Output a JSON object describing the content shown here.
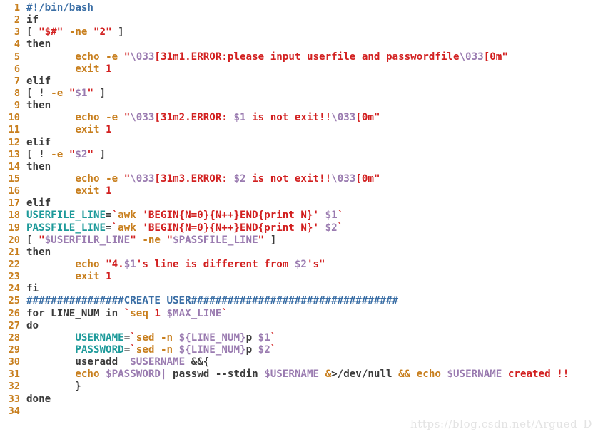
{
  "editor": {
    "language": "bash",
    "background_color": "#ffffff",
    "gutter_color": "#c87f1e",
    "colors": {
      "comment": "#3a6ea5",
      "string": "#d22020",
      "variable": "#9a7bb0",
      "command": "#c87f1e",
      "assignment_target": "#1d9a9a",
      "plain": "#3b3b3b",
      "number": "#d22020"
    },
    "total_lines": 34,
    "cursor_line": 16
  },
  "watermark": {
    "text": "https://blog.csdn.net/Argued_D"
  },
  "lines": [
    {
      "n": "1",
      "text": "#!/bin/bash"
    },
    {
      "n": "2",
      "text": "if"
    },
    {
      "n": "3",
      "text": "[ \"$#\" -ne \"2\" ]"
    },
    {
      "n": "4",
      "text": "then"
    },
    {
      "n": "5",
      "text": "        echo -e \"\\033[31m1.ERROR:please input userfile and passwordfile\\033[0m\""
    },
    {
      "n": "6",
      "text": "        exit 1"
    },
    {
      "n": "7",
      "text": "elif"
    },
    {
      "n": "8",
      "text": "[ ! -e \"$1\" ]"
    },
    {
      "n": "9",
      "text": "then"
    },
    {
      "n": "10",
      "text": "        echo -e \"\\033[31m2.ERROR: $1 is not exit!!\\033[0m\""
    },
    {
      "n": "11",
      "text": "        exit 1"
    },
    {
      "n": "12",
      "text": "elif"
    },
    {
      "n": "13",
      "text": "[ ! -e \"$2\" ]"
    },
    {
      "n": "14",
      "text": "then"
    },
    {
      "n": "15",
      "text": "        echo -e \"\\033[31m3.ERROR: $2 is not exit!!\\033[0m\""
    },
    {
      "n": "16",
      "text": "        exit 1"
    },
    {
      "n": "17",
      "text": "elif"
    },
    {
      "n": "18",
      "text": "USERFILE_LINE=`awk 'BEGIN{N=0}{N++}END{print N}' $1`"
    },
    {
      "n": "19",
      "text": "PASSFILE_LINE=`awk 'BEGIN{N=0}{N++}END{print N}' $2`"
    },
    {
      "n": "20",
      "text": "[ \"$USERFILR_LINE\" -ne \"$PASSFILE_LINE\" ]"
    },
    {
      "n": "21",
      "text": "then"
    },
    {
      "n": "22",
      "text": "        echo \"4.$1's line is different from $2's\""
    },
    {
      "n": "23",
      "text": "        exit 1"
    },
    {
      "n": "24",
      "text": "fi"
    },
    {
      "n": "25",
      "text": "################CREATE USER##################################"
    },
    {
      "n": "26",
      "text": "for LINE_NUM in `seq 1 $MAX_LINE`"
    },
    {
      "n": "27",
      "text": "do"
    },
    {
      "n": "28",
      "text": "        USERNAME=`sed -n ${LINE_NUM}p $1`"
    },
    {
      "n": "29",
      "text": "        PASSWORD=`sed -n ${LINE_NUM}p $2`"
    },
    {
      "n": "30",
      "text": "        useradd  $USERNAME &&{"
    },
    {
      "n": "31",
      "text": "        echo $PASSWORD| passwd --stdin $USERNAME &>/dev/null && echo $USERNAME created !!"
    },
    {
      "n": "32",
      "text": "        }"
    },
    {
      "n": "33",
      "text": "done"
    },
    {
      "n": "34",
      "text": ""
    }
  ],
  "highlight_spans": [
    {
      "line": 1,
      "spans": [
        [
          "#!/bin/bash",
          "comment"
        ]
      ]
    },
    {
      "line": 2,
      "spans": [
        [
          "if",
          "plain"
        ]
      ]
    },
    {
      "line": 3,
      "spans": [
        [
          "[ ",
          "plain"
        ],
        [
          "\"$#\"",
          "string"
        ],
        [
          " ",
          "plain"
        ],
        [
          "-ne",
          "command"
        ],
        [
          " ",
          "plain"
        ],
        [
          "\"",
          "string"
        ],
        [
          "2",
          "number"
        ],
        [
          "\"",
          "string"
        ],
        [
          " ]",
          "plain"
        ]
      ]
    },
    {
      "line": 4,
      "spans": [
        [
          "then",
          "plain"
        ]
      ]
    },
    {
      "line": 5,
      "spans": [
        [
          "        ",
          "plain"
        ],
        [
          "echo",
          "command"
        ],
        [
          " ",
          "plain"
        ],
        [
          "-e",
          "command"
        ],
        [
          " ",
          "plain"
        ],
        [
          "\"",
          "string"
        ],
        [
          "\\033",
          "variable"
        ],
        [
          "[31m1.ERROR:please input userfile and passwordfile",
          "string"
        ],
        [
          "\\033",
          "variable"
        ],
        [
          "[0m",
          "string"
        ],
        [
          "\"",
          "string"
        ]
      ]
    },
    {
      "line": 6,
      "spans": [
        [
          "        ",
          "plain"
        ],
        [
          "exit",
          "command"
        ],
        [
          " ",
          "plain"
        ],
        [
          "1",
          "number"
        ]
      ]
    },
    {
      "line": 7,
      "spans": [
        [
          "elif",
          "plain"
        ]
      ]
    },
    {
      "line": 8,
      "spans": [
        [
          "[ ! ",
          "plain"
        ],
        [
          "-e",
          "command"
        ],
        [
          " ",
          "plain"
        ],
        [
          "\"",
          "string"
        ],
        [
          "$1",
          "variable"
        ],
        [
          "\"",
          "string"
        ],
        [
          " ]",
          "plain"
        ]
      ]
    },
    {
      "line": 9,
      "spans": [
        [
          "then",
          "plain"
        ]
      ]
    },
    {
      "line": 10,
      "spans": [
        [
          "        ",
          "plain"
        ],
        [
          "echo",
          "command"
        ],
        [
          " ",
          "plain"
        ],
        [
          "-e",
          "command"
        ],
        [
          " ",
          "plain"
        ],
        [
          "\"",
          "string"
        ],
        [
          "\\033",
          "variable"
        ],
        [
          "[31m2.ERROR: ",
          "string"
        ],
        [
          "$1",
          "variable"
        ],
        [
          " is not exit!!",
          "string"
        ],
        [
          "\\033",
          "variable"
        ],
        [
          "[0m",
          "string"
        ],
        [
          "\"",
          "string"
        ]
      ]
    },
    {
      "line": 11,
      "spans": [
        [
          "        ",
          "plain"
        ],
        [
          "exit",
          "command"
        ],
        [
          " ",
          "plain"
        ],
        [
          "1",
          "number"
        ]
      ]
    },
    {
      "line": 12,
      "spans": [
        [
          "elif",
          "plain"
        ]
      ]
    },
    {
      "line": 13,
      "spans": [
        [
          "[ ! ",
          "plain"
        ],
        [
          "-e",
          "command"
        ],
        [
          " ",
          "plain"
        ],
        [
          "\"",
          "string"
        ],
        [
          "$2",
          "variable"
        ],
        [
          "\"",
          "string"
        ],
        [
          " ]",
          "plain"
        ]
      ]
    },
    {
      "line": 14,
      "spans": [
        [
          "then",
          "plain"
        ]
      ]
    },
    {
      "line": 15,
      "spans": [
        [
          "        ",
          "plain"
        ],
        [
          "echo",
          "command"
        ],
        [
          " ",
          "plain"
        ],
        [
          "-e",
          "command"
        ],
        [
          " ",
          "plain"
        ],
        [
          "\"",
          "string"
        ],
        [
          "\\033",
          "variable"
        ],
        [
          "[31m3.ERROR: ",
          "string"
        ],
        [
          "$2",
          "variable"
        ],
        [
          " is not exit!!",
          "string"
        ],
        [
          "\\033",
          "variable"
        ],
        [
          "[0m",
          "string"
        ],
        [
          "\"",
          "string"
        ]
      ]
    },
    {
      "line": 16,
      "spans": [
        [
          "        ",
          "plain"
        ],
        [
          "exit",
          "command"
        ],
        [
          " ",
          "plain"
        ],
        [
          "1",
          "cursor"
        ]
      ]
    },
    {
      "line": 17,
      "spans": [
        [
          "elif",
          "plain"
        ]
      ]
    },
    {
      "line": 18,
      "spans": [
        [
          "USERFILE_LINE",
          "assign"
        ],
        [
          "=",
          "plain"
        ],
        [
          "`",
          "string"
        ],
        [
          "awk",
          "command"
        ],
        [
          " ",
          "plain"
        ],
        [
          "'BEGIN{N=0}{N++}END{print N}'",
          "string"
        ],
        [
          " ",
          "plain"
        ],
        [
          "$1",
          "variable"
        ],
        [
          "`",
          "string"
        ]
      ]
    },
    {
      "line": 19,
      "spans": [
        [
          "PASSFILE_LINE",
          "assign"
        ],
        [
          "=",
          "plain"
        ],
        [
          "`",
          "string"
        ],
        [
          "awk",
          "command"
        ],
        [
          " ",
          "plain"
        ],
        [
          "'BEGIN{N=0}{N++}END{print N}'",
          "string"
        ],
        [
          " ",
          "plain"
        ],
        [
          "$2",
          "variable"
        ],
        [
          "`",
          "string"
        ]
      ]
    },
    {
      "line": 20,
      "spans": [
        [
          "[ ",
          "plain"
        ],
        [
          "\"",
          "string"
        ],
        [
          "$USERFILR_LINE",
          "variable"
        ],
        [
          "\"",
          "string"
        ],
        [
          " ",
          "plain"
        ],
        [
          "-ne",
          "command"
        ],
        [
          " ",
          "plain"
        ],
        [
          "\"",
          "string"
        ],
        [
          "$PASSFILE_LINE",
          "variable"
        ],
        [
          "\"",
          "string"
        ],
        [
          " ]",
          "plain"
        ]
      ]
    },
    {
      "line": 21,
      "spans": [
        [
          "then",
          "plain"
        ]
      ]
    },
    {
      "line": 22,
      "spans": [
        [
          "        ",
          "plain"
        ],
        [
          "echo",
          "command"
        ],
        [
          " ",
          "plain"
        ],
        [
          "\"4.",
          "string"
        ],
        [
          "$1",
          "variable"
        ],
        [
          "'s line is different from ",
          "string"
        ],
        [
          "$2",
          "variable"
        ],
        [
          "'s\"",
          "string"
        ]
      ]
    },
    {
      "line": 23,
      "spans": [
        [
          "        ",
          "plain"
        ],
        [
          "exit",
          "command"
        ],
        [
          " ",
          "plain"
        ],
        [
          "1",
          "number"
        ]
      ]
    },
    {
      "line": 24,
      "spans": [
        [
          "fi",
          "plain"
        ]
      ]
    },
    {
      "line": 25,
      "spans": [
        [
          "################CREATE USER##################################",
          "comment"
        ]
      ]
    },
    {
      "line": 26,
      "spans": [
        [
          "for",
          "plain"
        ],
        [
          " LINE_NUM ",
          "plain"
        ],
        [
          "in",
          "plain"
        ],
        [
          " ",
          "plain"
        ],
        [
          "`",
          "string"
        ],
        [
          "seq",
          "command"
        ],
        [
          " ",
          "plain"
        ],
        [
          "1",
          "number"
        ],
        [
          " ",
          "plain"
        ],
        [
          "$MAX_LINE",
          "variable"
        ],
        [
          "`",
          "string"
        ]
      ]
    },
    {
      "line": 27,
      "spans": [
        [
          "do",
          "plain"
        ]
      ]
    },
    {
      "line": 28,
      "spans": [
        [
          "        ",
          "plain"
        ],
        [
          "USERNAME",
          "assign"
        ],
        [
          "=",
          "plain"
        ],
        [
          "`",
          "string"
        ],
        [
          "sed",
          "command"
        ],
        [
          " ",
          "plain"
        ],
        [
          "-n",
          "command"
        ],
        [
          " ",
          "plain"
        ],
        [
          "${LINE_NUM}",
          "variable"
        ],
        [
          "p ",
          "plain"
        ],
        [
          "$1",
          "variable"
        ],
        [
          "`",
          "string"
        ]
      ]
    },
    {
      "line": 29,
      "spans": [
        [
          "        ",
          "plain"
        ],
        [
          "PASSWORD",
          "assign"
        ],
        [
          "=",
          "plain"
        ],
        [
          "`",
          "string"
        ],
        [
          "sed",
          "command"
        ],
        [
          " ",
          "plain"
        ],
        [
          "-n",
          "command"
        ],
        [
          " ",
          "plain"
        ],
        [
          "${LINE_NUM}",
          "variable"
        ],
        [
          "p ",
          "plain"
        ],
        [
          "$2",
          "variable"
        ],
        [
          "`",
          "string"
        ]
      ]
    },
    {
      "line": 30,
      "spans": [
        [
          "        ",
          "plain"
        ],
        [
          "useradd",
          "plain"
        ],
        [
          "  ",
          "plain"
        ],
        [
          "$USERNAME",
          "variable"
        ],
        [
          " ",
          "plain"
        ],
        [
          "&&",
          "plain"
        ],
        [
          "{",
          "plain"
        ]
      ]
    },
    {
      "line": 31,
      "spans": [
        [
          "        ",
          "plain"
        ],
        [
          "echo",
          "command"
        ],
        [
          " ",
          "plain"
        ],
        [
          "$PASSWORD",
          "variable"
        ],
        [
          "|",
          "variable"
        ],
        [
          " ",
          "plain"
        ],
        [
          "passwd",
          "plain"
        ],
        [
          " ",
          "plain"
        ],
        [
          "--stdin",
          "plain"
        ],
        [
          " ",
          "plain"
        ],
        [
          "$USERNAME",
          "variable"
        ],
        [
          " ",
          "plain"
        ],
        [
          "&",
          "command"
        ],
        [
          ">/dev/null",
          "plain"
        ],
        [
          " ",
          "plain"
        ],
        [
          "&&",
          "command"
        ],
        [
          " ",
          "plain"
        ],
        [
          "echo",
          "command"
        ],
        [
          " ",
          "plain"
        ],
        [
          "$USERNAME",
          "variable"
        ],
        [
          " ",
          "plain"
        ],
        [
          "created !!",
          "string"
        ]
      ]
    },
    {
      "line": 32,
      "spans": [
        [
          "        ",
          "plain"
        ],
        [
          "}",
          "plain"
        ]
      ]
    },
    {
      "line": 33,
      "spans": [
        [
          "done",
          "plain"
        ]
      ]
    },
    {
      "line": 34,
      "spans": [
        [
          "",
          "plain"
        ]
      ]
    }
  ]
}
